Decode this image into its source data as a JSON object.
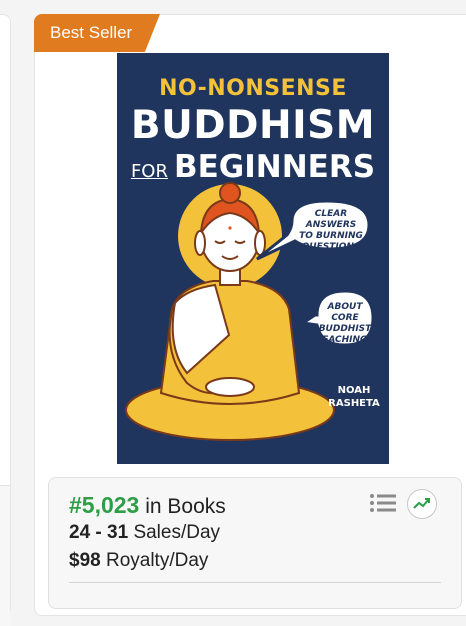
{
  "badge": {
    "label": "Best Seller",
    "color": "#e07b1f"
  },
  "book": {
    "cover_line1": "NO-NONSENSE",
    "cover_line2": "BUDDHISM",
    "cover_line3_prefix": "FOR",
    "cover_line3_main": "BEGINNERS",
    "bubble1": [
      "CLEAR ANSWERS",
      "TO BURNING",
      "QUESTIONS"
    ],
    "bubble2": [
      "ABOUT CORE",
      "BUDDHIST",
      "TEACHINGS"
    ],
    "author": [
      "NOAH",
      "RASHETA"
    ],
    "cover_color": "#20355d"
  },
  "stats": {
    "rank": "#5,023",
    "rank_category": "in Books",
    "sales_range": "24 - 31",
    "sales_unit": "Sales/Day",
    "royalty": "$98",
    "royalty_unit": "Royalty/Day",
    "rank_color": "#2e9e46"
  },
  "icons": {
    "list": "list-icon",
    "trend": "trend-chart-icon"
  }
}
